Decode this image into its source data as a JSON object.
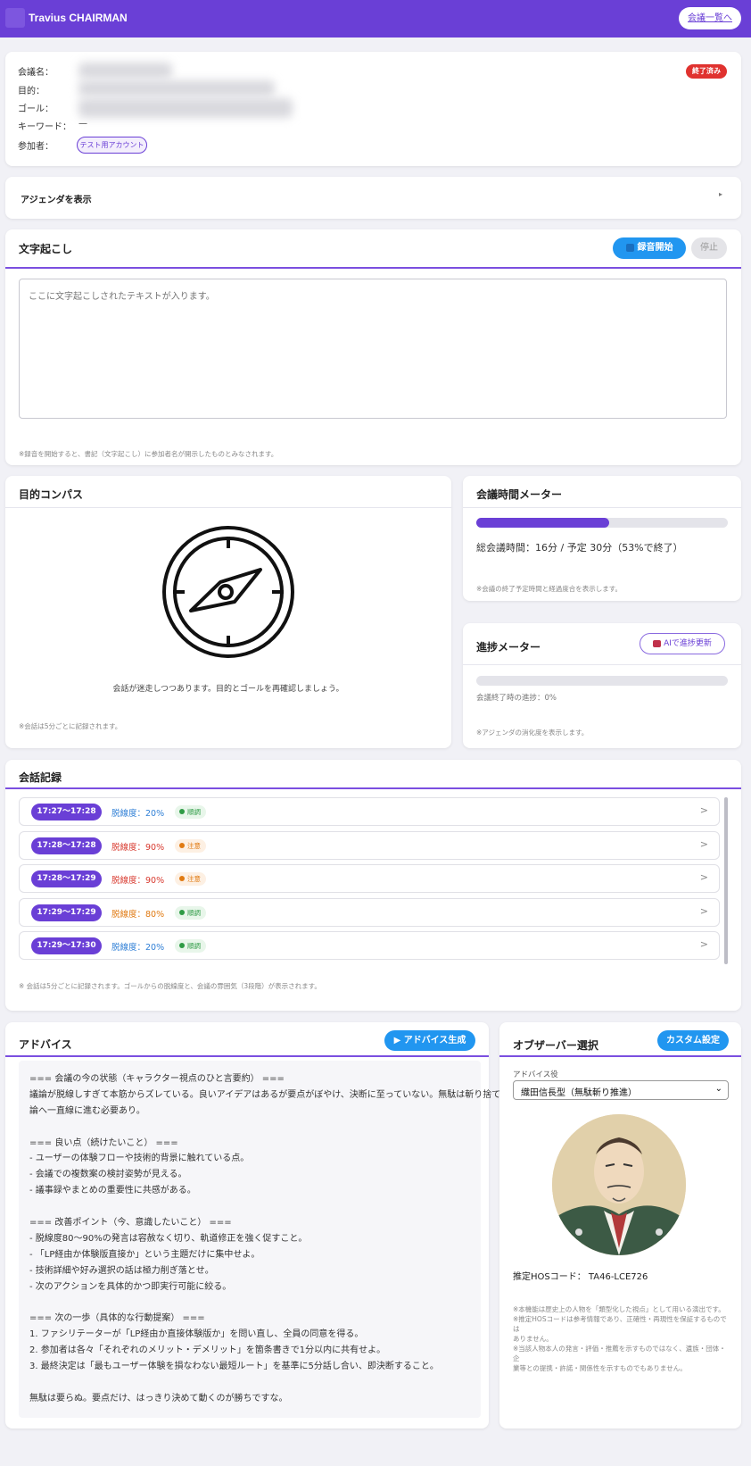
{
  "header": {
    "app_title": "Travius CHAIRMAN",
    "back_label": "会議一覧へ"
  },
  "meeting": {
    "labels": {
      "name": "会議名：",
      "purpose": "目的：",
      "goal": "ゴール：",
      "keywords": "キーワード：",
      "participants": "参加者："
    },
    "keywords_value": "—",
    "participant": "テスト用アカウント",
    "status": "終了済み"
  },
  "agenda": {
    "label": "アジェンダを表示",
    "toggle": "▸"
  },
  "transcription": {
    "title": "文字起こし",
    "record_label": "録音開始",
    "stop_label": "停止",
    "placeholder": "ここに文字起こしされたテキストが入ります。",
    "note": "※録音を開始すると、書記（文字起こし）に参加者名が開示したものとみなされます。"
  },
  "compass": {
    "title": "目的コンパス",
    "message": "会話が迷走しつつあります。目的とゴールを再確認しましょう。",
    "note": "※会話は5分ごとに記録されます。"
  },
  "time_meter": {
    "title": "会議時間メーター",
    "summary": "総会議時間：16分 / 予定 30分（53%で終了）",
    "progress": 0.53,
    "note": "※会議の終了予定時間と経過度合を表示します。"
  },
  "progress_meter": {
    "title": "進捗メーター",
    "button": "AIで進捗更新",
    "progress": 0,
    "status": "会議終了時の進捗：0%",
    "note": "※アジェンダの消化度を表示します。"
  },
  "log": {
    "title": "会話記録",
    "rows": [
      {
        "time": "17:27〜17:28",
        "deviation": "脱線度：20%",
        "level": "low",
        "state": "順調"
      },
      {
        "time": "17:28〜17:28",
        "deviation": "脱線度：90%",
        "level": "high",
        "state": "注意"
      },
      {
        "time": "17:28〜17:29",
        "deviation": "脱線度：90%",
        "level": "high",
        "state": "注意"
      },
      {
        "time": "17:29〜17:29",
        "deviation": "脱線度：80%",
        "level": "mid",
        "state": "順調"
      },
      {
        "time": "17:29〜17:30",
        "deviation": "脱線度：20%",
        "level": "low",
        "state": "順調"
      }
    ],
    "note": "※ 会話は5分ごとに記録されます。ゴールからの脱線度と、会議の雰囲気（3段階）が表示されます。",
    "colors": {
      "low": "#2f7fd6",
      "mid": "#e07a12",
      "high": "#d83a2f"
    }
  },
  "advice": {
    "title": "アドバイス",
    "button": "▶ アドバイス生成",
    "lines": [
      "=== 会議の今の状態（キャラクター視点のひと言要約） ===",
      "議論が脱線しすぎて本筋からズレている。良いアイデアはあるが要点がぼやけ、決断に至っていない。無駄は斬り捨て、結",
      "論へ一直線に進む必要あり。",
      "",
      "=== 良い点（続けたいこと） ===",
      "- ユーザーの体験フローや技術的背景に触れている点。",
      "- 会議での複数案の検討姿勢が見える。",
      "- 議事録やまとめの重要性に共感がある。",
      "",
      "=== 改善ポイント（今、意識したいこと） ===",
      "- 脱線度80〜90%の発言は容赦なく切り、軌道修正を強く促すこと。",
      "- 「LP経由か体験版直接か」という主題だけに集中せよ。",
      "- 技術詳細や好み選択の話は極力削ぎ落とせ。",
      "- 次のアクションを具体的かつ即実行可能に絞る。",
      "",
      "=== 次の一歩（具体的な行動提案） ===",
      "1. ファシリテーターが「LP経由か直接体験版か」を問い直し、全員の同意を得る。",
      "2. 参加者は各々「それぞれのメリット・デメリット」を箇条書きで1分以内に共有せよ。",
      "3. 最終決定は「最もユーザー体験を損なわない最短ルート」を基準に5分話し合い、即決断すること。",
      "",
      "無駄は要らぬ。要点だけ、はっきり決めて動くのが勝ちですな。"
    ]
  },
  "observer": {
    "title": "オブザーバー選択",
    "button": "カスタム設定",
    "role_label": "アドバイス役",
    "selected": "織田信長型（無駄斬り推進）",
    "code": "推定HOSコード： TA46-LCE726",
    "notes": [
      "※本機能は歴史上の人物を「類型化した視点」として用いる演出です。",
      "※推定HOSコードは参考情報であり、正確性・再現性を保証するものでは",
      "ありません。",
      "※当該人物本人の発言・評価・推薦を示すものではなく、遺族・団体・企",
      "業等との提携・許諾・関係性を示すものでもありません。"
    ]
  }
}
